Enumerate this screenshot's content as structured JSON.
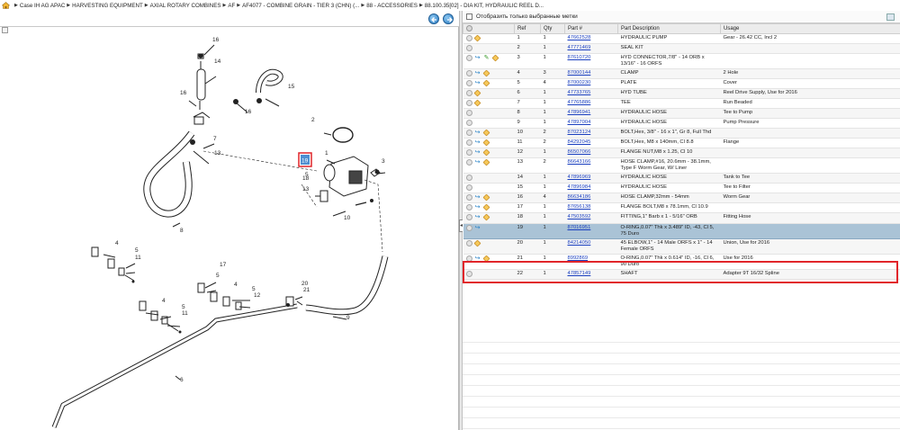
{
  "breadcrumb": {
    "items": [
      "Case IH AG APAC",
      "HARVESTING EQUIPMENT",
      "AXIAL ROTARY COMBINES",
      "AF",
      "AF4077 - COMBINE GRAIN - TIER 3 (CHN) (...",
      "88 - ACCESSORIES",
      "88.100.35[02] - DIA KIT, HYDRAULIC REEL D..."
    ],
    "separator": "▶"
  },
  "filter": {
    "label": "Отобразить только выбранные метки"
  },
  "table": {
    "headers": [
      "",
      "Ref",
      "Qty",
      "Part #",
      "Part Description",
      "Usage"
    ],
    "rows": [
      {
        "icons": [
          "cart",
          "info"
        ],
        "ref": "1",
        "qty": "1",
        "part": "47662528",
        "desc": "HYDRAULIC PUMP",
        "usage": "Gear - 26.42 CC, Incl 2"
      },
      {
        "icons": [
          "cart"
        ],
        "ref": "2",
        "qty": "1",
        "part": "47771469",
        "desc": "SEAL KIT",
        "usage": ""
      },
      {
        "icons": [
          "cart",
          "sub",
          "note",
          "info"
        ],
        "ref": "3",
        "qty": "1",
        "part": "87610720",
        "desc": "HYD CONNECTOR,7/8\" - 14 ORB x 13/16\" - 16 ORFS",
        "usage": ""
      },
      {
        "icons": [
          "cart",
          "sub",
          "info"
        ],
        "ref": "4",
        "qty": "3",
        "part": "87000144",
        "desc": "CLAMP",
        "usage": "2 Hole"
      },
      {
        "icons": [
          "cart",
          "sub",
          "info"
        ],
        "ref": "5",
        "qty": "4",
        "part": "87000230",
        "desc": "PLATE",
        "usage": "Cover"
      },
      {
        "icons": [
          "cart",
          "info"
        ],
        "ref": "6",
        "qty": "1",
        "part": "47733765",
        "desc": "HYD TUBE",
        "usage": "Reel Drive Supply, Use for 2016"
      },
      {
        "icons": [
          "cart",
          "info"
        ],
        "ref": "7",
        "qty": "1",
        "part": "47765886",
        "desc": "TEE",
        "usage": "Run Beaded"
      },
      {
        "icons": [
          "cart"
        ],
        "ref": "8",
        "qty": "1",
        "part": "47896941",
        "desc": "HYDRAULIC HOSE",
        "usage": "Tee to Pump"
      },
      {
        "icons": [
          "cart"
        ],
        "ref": "9",
        "qty": "1",
        "part": "47897004",
        "desc": "HYDRAULIC HOSE",
        "usage": "Pump Pressure"
      },
      {
        "icons": [
          "cart",
          "sub",
          "info"
        ],
        "ref": "10",
        "qty": "2",
        "part": "87023124",
        "desc": "BOLT,Hex, 3/8\" - 16 x 1\", Gr 8, Full Thd",
        "usage": ""
      },
      {
        "icons": [
          "cart",
          "sub",
          "info"
        ],
        "ref": "11",
        "qty": "2",
        "part": "84292045",
        "desc": "BOLT,Hex, M8 x 140mm, Cl 8.8",
        "usage": "Flange"
      },
      {
        "icons": [
          "cart",
          "sub",
          "info"
        ],
        "ref": "12",
        "qty": "1",
        "part": "86507066",
        "desc": "FLANGE NUT,M8 x 1.25, Cl 10",
        "usage": ""
      },
      {
        "icons": [
          "cart",
          "sub",
          "info"
        ],
        "ref": "13",
        "qty": "2",
        "part": "86643166",
        "desc": "HOSE CLAMP,#16, 20.6mm - 38.1mm, Type F Worm Gear, W/ Liner",
        "usage": ""
      },
      {
        "icons": [
          "cart"
        ],
        "ref": "14",
        "qty": "1",
        "part": "47896969",
        "desc": "HYDRAULIC HOSE",
        "usage": "Tank to Tee"
      },
      {
        "icons": [
          "cart"
        ],
        "ref": "15",
        "qty": "1",
        "part": "47896984",
        "desc": "HYDRAULIC HOSE",
        "usage": "Tee to Filter"
      },
      {
        "icons": [
          "cart",
          "sub",
          "info"
        ],
        "ref": "16",
        "qty": "4",
        "part": "86634186",
        "desc": "HOSE CLAMP,32mm - 54mm",
        "usage": "Worm Gear"
      },
      {
        "icons": [
          "cart",
          "sub",
          "info"
        ],
        "ref": "17",
        "qty": "1",
        "part": "87656138",
        "desc": "FLANGE BOLT,M8 x 78.1mm, Cl 10.9",
        "usage": ""
      },
      {
        "icons": [
          "cart",
          "sub",
          "info"
        ],
        "ref": "18",
        "qty": "1",
        "part": "47503592",
        "desc": "FITTING,1\" Barb x 1 - 5/16\" ORB",
        "usage": "Fitting Hose"
      },
      {
        "icons": [
          "cart",
          "sub"
        ],
        "ref": "19",
        "qty": "1",
        "part": "87016951",
        "desc": "O-RING,0.07\" Thk x 3.489\" ID, -43, Cl 5, 75 Duro",
        "usage": "",
        "selected": true
      },
      {
        "icons": [
          "cart",
          "info"
        ],
        "ref": "20",
        "qty": "1",
        "part": "84214050",
        "desc": "45 ELBOW,1\" - 14 Male ORFS x 1\" - 14 Female ORFS",
        "usage": "Union, Use for 2016"
      },
      {
        "icons": [
          "cart",
          "sub",
          "info"
        ],
        "ref": "21",
        "qty": "1",
        "part": "8992869",
        "desc": "O-RING,0.07\" Thk x 0.614\" ID, -16, Cl 6, 90 Duro",
        "usage": "Use for 2016"
      },
      {
        "icons": [
          "cart"
        ],
        "ref": "22",
        "qty": "1",
        "part": "47857149",
        "desc": "SHAFT",
        "usage": "Adapter 9T 16/32 Spline"
      }
    ]
  },
  "diagram": {
    "labels": [
      "16",
      "14",
      "15",
      "16",
      "16",
      "2",
      "7",
      "13",
      "19",
      "1",
      "3",
      "5",
      "18",
      "13",
      "10",
      "8",
      "4",
      "5",
      "11",
      "17",
      "5",
      "4",
      "5",
      "12",
      "20",
      "21",
      "4",
      "5",
      "11",
      "9",
      "6"
    ],
    "highlight_label": "19"
  },
  "colors": {
    "selected_row": "#aac3d6",
    "highlight": "#e1252a",
    "link": "#1a3fbf"
  }
}
